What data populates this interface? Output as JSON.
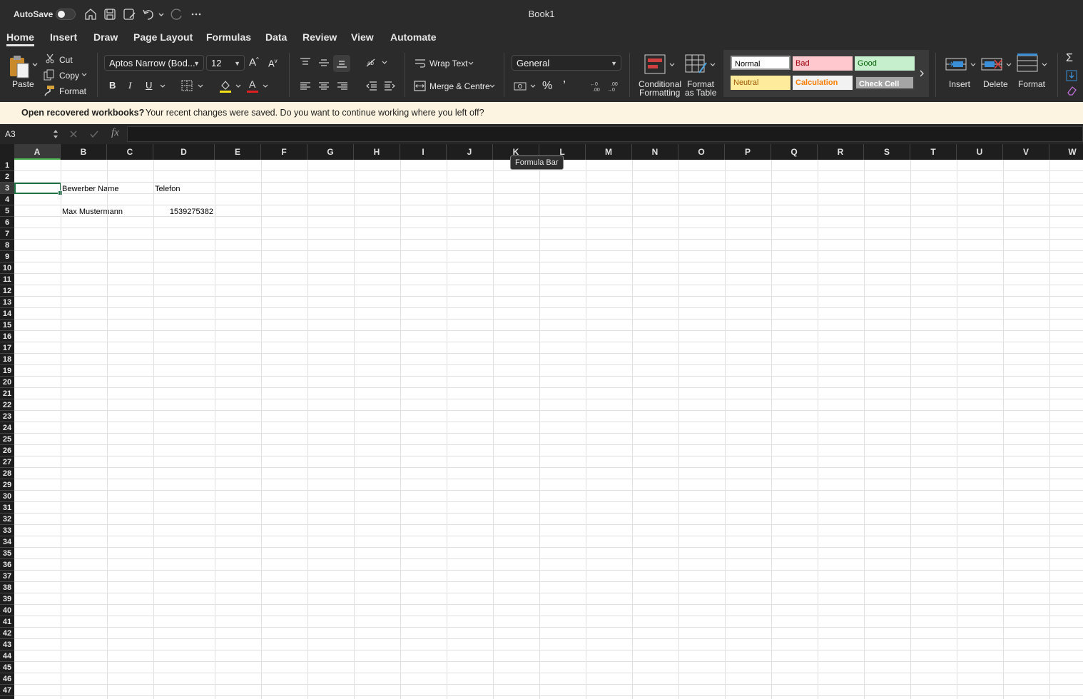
{
  "titlebar": {
    "autosave_label": "AutoSave",
    "doc_title": "Book1"
  },
  "tabs": [
    "Home",
    "Insert",
    "Draw",
    "Page Layout",
    "Formulas",
    "Data",
    "Review",
    "View",
    "Automate"
  ],
  "clipboard": {
    "paste": "Paste",
    "cut": "Cut",
    "copy": "Copy",
    "format": "Format"
  },
  "font": {
    "name": "Aptos Narrow (Bod...",
    "size": "12"
  },
  "alignment": {
    "wrap": "Wrap Text",
    "merge": "Merge & Centre"
  },
  "number": {
    "format": "General"
  },
  "styles": {
    "conditional": "Conditional",
    "conditional2": "Formatting",
    "format_table": "Format",
    "format_table2": "as Table",
    "normal": "Normal",
    "bad": "Bad",
    "good": "Good",
    "neutral": "Neutral",
    "calculation": "Calculation",
    "check_cell": "Check Cell"
  },
  "cells_group": {
    "insert": "Insert",
    "delete": "Delete",
    "format": "Format"
  },
  "banner": {
    "title": "Open recovered workbooks?",
    "message": "Your recent changes were saved. Do you want to continue working where you left off?"
  },
  "formula_bar": {
    "name_box": "A3",
    "fx": "fx"
  },
  "tooltip": "Formula Bar",
  "columns": [
    "A",
    "B",
    "C",
    "D",
    "E",
    "F",
    "G",
    "H",
    "I",
    "J",
    "K",
    "L",
    "M",
    "N",
    "O",
    "P",
    "Q",
    "R",
    "S",
    "T",
    "U",
    "V",
    "W"
  ],
  "rows": [
    "1",
    "2",
    "3",
    "4",
    "5",
    "6",
    "7",
    "8",
    "9",
    "10",
    "11",
    "12",
    "13",
    "14",
    "15",
    "16",
    "17",
    "18",
    "19",
    "20",
    "21",
    "22",
    "23",
    "24",
    "25",
    "26",
    "27",
    "28",
    "29",
    "30",
    "31",
    "32",
    "33",
    "34",
    "35",
    "36",
    "37",
    "38",
    "39",
    "40",
    "41",
    "42",
    "43",
    "44",
    "45",
    "46",
    "47"
  ],
  "sheet": {
    "b3": "Bewerber Name",
    "d3": "Telefon",
    "b5": "Max Mustermann",
    "d5": "1539275382"
  },
  "colors": {
    "accent": "#217346",
    "banner_bg": "#fcf4e0"
  }
}
